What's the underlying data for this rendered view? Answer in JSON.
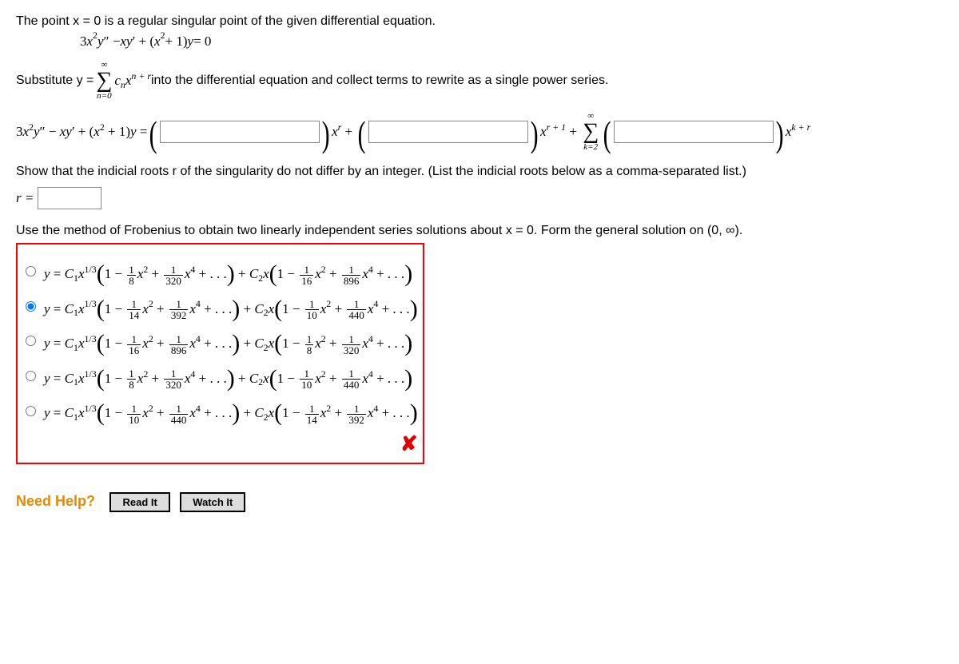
{
  "intro": "The point x = 0 is a regular singular point of the given differential equation.",
  "ode": "3x²y″ − xy′ + (x² + 1)y = 0",
  "substitute_pre": "Substitute y = ",
  "substitute_post": " into the differential equation and collect terms to rewrite as a single power series.",
  "series_top": "∞",
  "series_bot": "n=0",
  "series_term": "cₙxⁿ⁺ʳ",
  "lhs": "3x²y″ − xy′ + (x² + 1)y = ",
  "xr": "xʳ",
  "plus": " + ",
  "xr1": "xʳ⁺¹",
  "sum_top": "∞",
  "sum_bot": "k=2",
  "xkr": "xᵏ⁺ʳ",
  "indicial_text": "Show that the indicial roots r of the singularity do not differ by an integer. (List the indicial roots below as a comma-separated list.)",
  "r_label": "r =",
  "frobenius_text": "Use the method of Frobenius to obtain two linearly independent series solutions about x = 0. Form the general solution on (0, ∞).",
  "options": [
    {
      "a": "8",
      "b": "320",
      "c": "16",
      "d": "896",
      "selected": false
    },
    {
      "a": "14",
      "b": "392",
      "c": "10",
      "d": "440",
      "selected": true
    },
    {
      "a": "16",
      "b": "896",
      "c": "8",
      "d": "320",
      "selected": false
    },
    {
      "a": "8",
      "b": "320",
      "c": "10",
      "d": "440",
      "selected": false
    },
    {
      "a": "10",
      "b": "440",
      "c": "14",
      "d": "392",
      "selected": false
    }
  ],
  "need_help": "Need Help?",
  "read_it": "Read It",
  "watch_it": "Watch It",
  "wrong_mark": "✘"
}
